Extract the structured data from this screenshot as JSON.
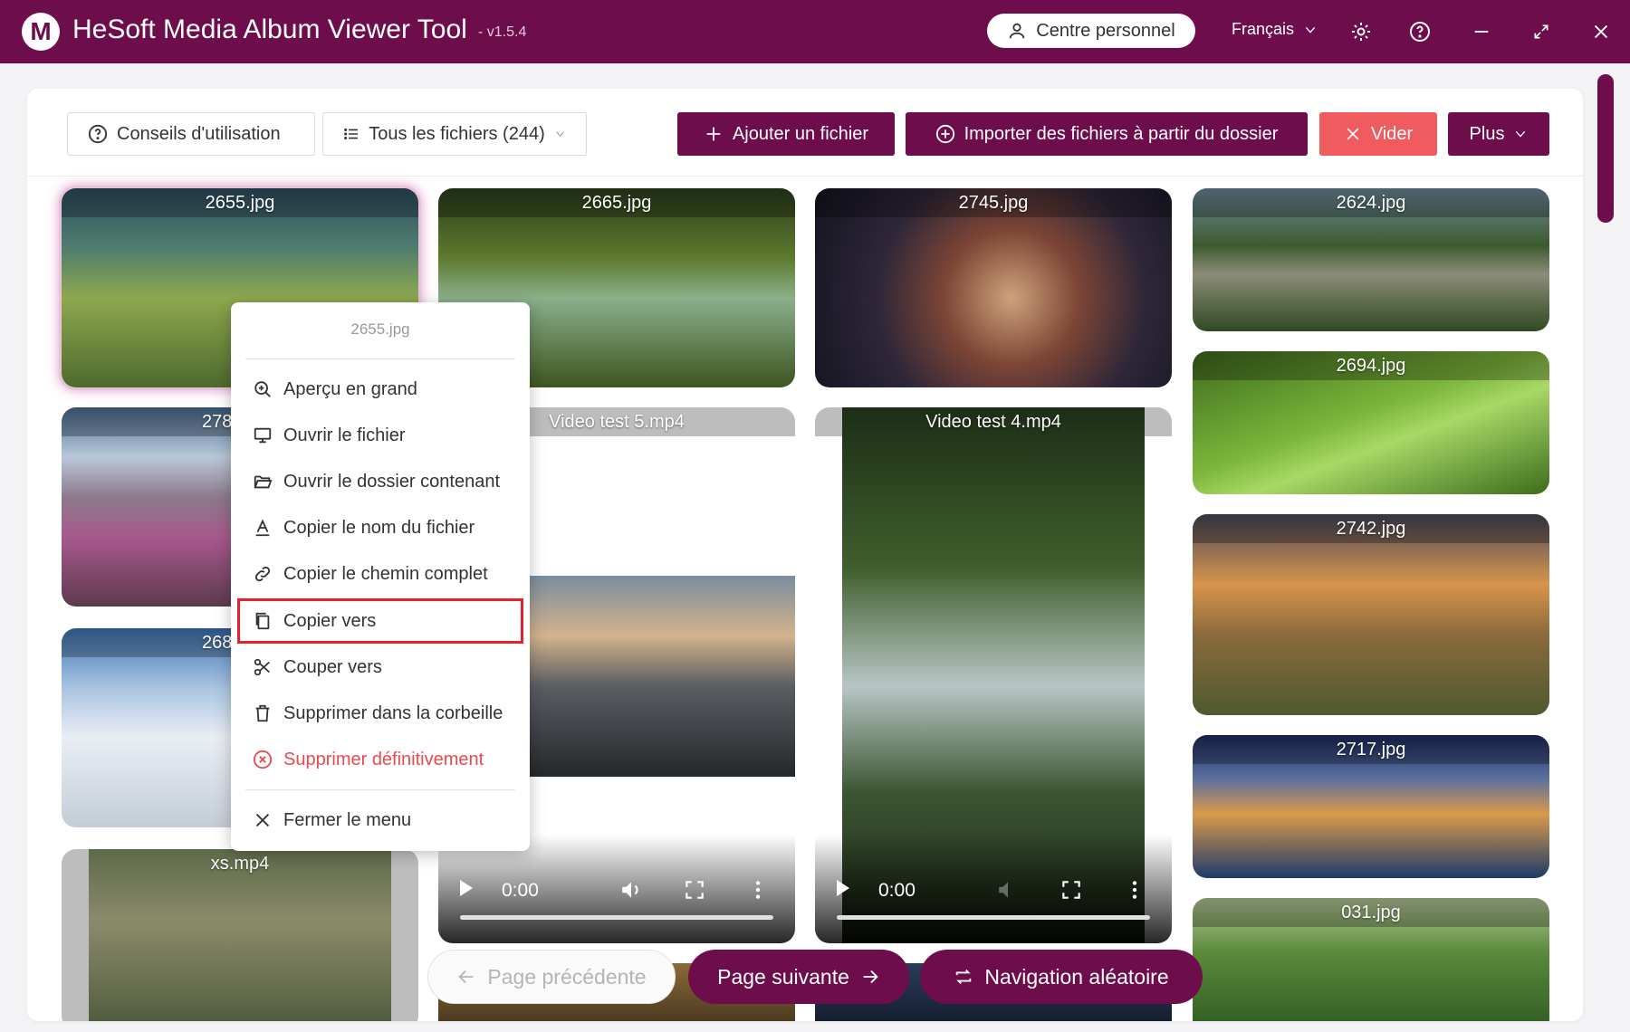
{
  "app": {
    "logo_letter": "M",
    "title": "HeSoft Media Album Viewer Tool",
    "version": "- v1.5.4",
    "user_center": "Centre personnel",
    "language": "Français"
  },
  "toolbar": {
    "tips": "Conseils d'utilisation",
    "filter": "Tous les fichiers (244)",
    "add_file": "Ajouter un fichier",
    "import_folder": "Importer des fichiers à partir du dossier",
    "clear": "Vider",
    "more": "Plus"
  },
  "tiles": [
    {
      "label": "2655.jpg"
    },
    {
      "label": "2665.jpg"
    },
    {
      "label": "2745.jpg"
    },
    {
      "label": "2624.jpg"
    },
    {
      "label": "278"
    },
    {
      "label": "Video test 5.mp4"
    },
    {
      "label": "Video test 4.mp4"
    },
    {
      "label": "2694.jpg"
    },
    {
      "label": "268"
    },
    {
      "label": "2742.jpg"
    },
    {
      "label": "2717.jpg"
    },
    {
      "label": "xs.mp4"
    },
    {
      "label": "031.jpg"
    }
  ],
  "video": {
    "time_a": "0:00",
    "time_b": "0:00"
  },
  "context_menu": {
    "title": "2655.jpg",
    "items": [
      {
        "label": "Aperçu en grand",
        "icon": "zoom-in-icon"
      },
      {
        "label": "Ouvrir le fichier",
        "icon": "monitor-icon"
      },
      {
        "label": "Ouvrir le dossier contenant",
        "icon": "folder-open-icon"
      },
      {
        "label": "Copier le nom du fichier",
        "icon": "text-icon"
      },
      {
        "label": "Copier le chemin complet",
        "icon": "link-icon"
      },
      {
        "label": "Copier vers",
        "icon": "copy-icon"
      },
      {
        "label": "Couper vers",
        "icon": "scissors-icon"
      },
      {
        "label": "Supprimer dans la corbeille",
        "icon": "trash-icon"
      },
      {
        "label": "Supprimer définitivement",
        "icon": "close-circle-icon"
      },
      {
        "label": "Fermer le menu",
        "icon": "close-icon"
      }
    ]
  },
  "pagination": {
    "prev": "Page précédente",
    "next": "Page suivante",
    "random": "Navigation aléatoire"
  },
  "colors": {
    "brand": "#6e0d4b",
    "danger": "#f05b5f",
    "highlight_border": "#e3222b"
  }
}
